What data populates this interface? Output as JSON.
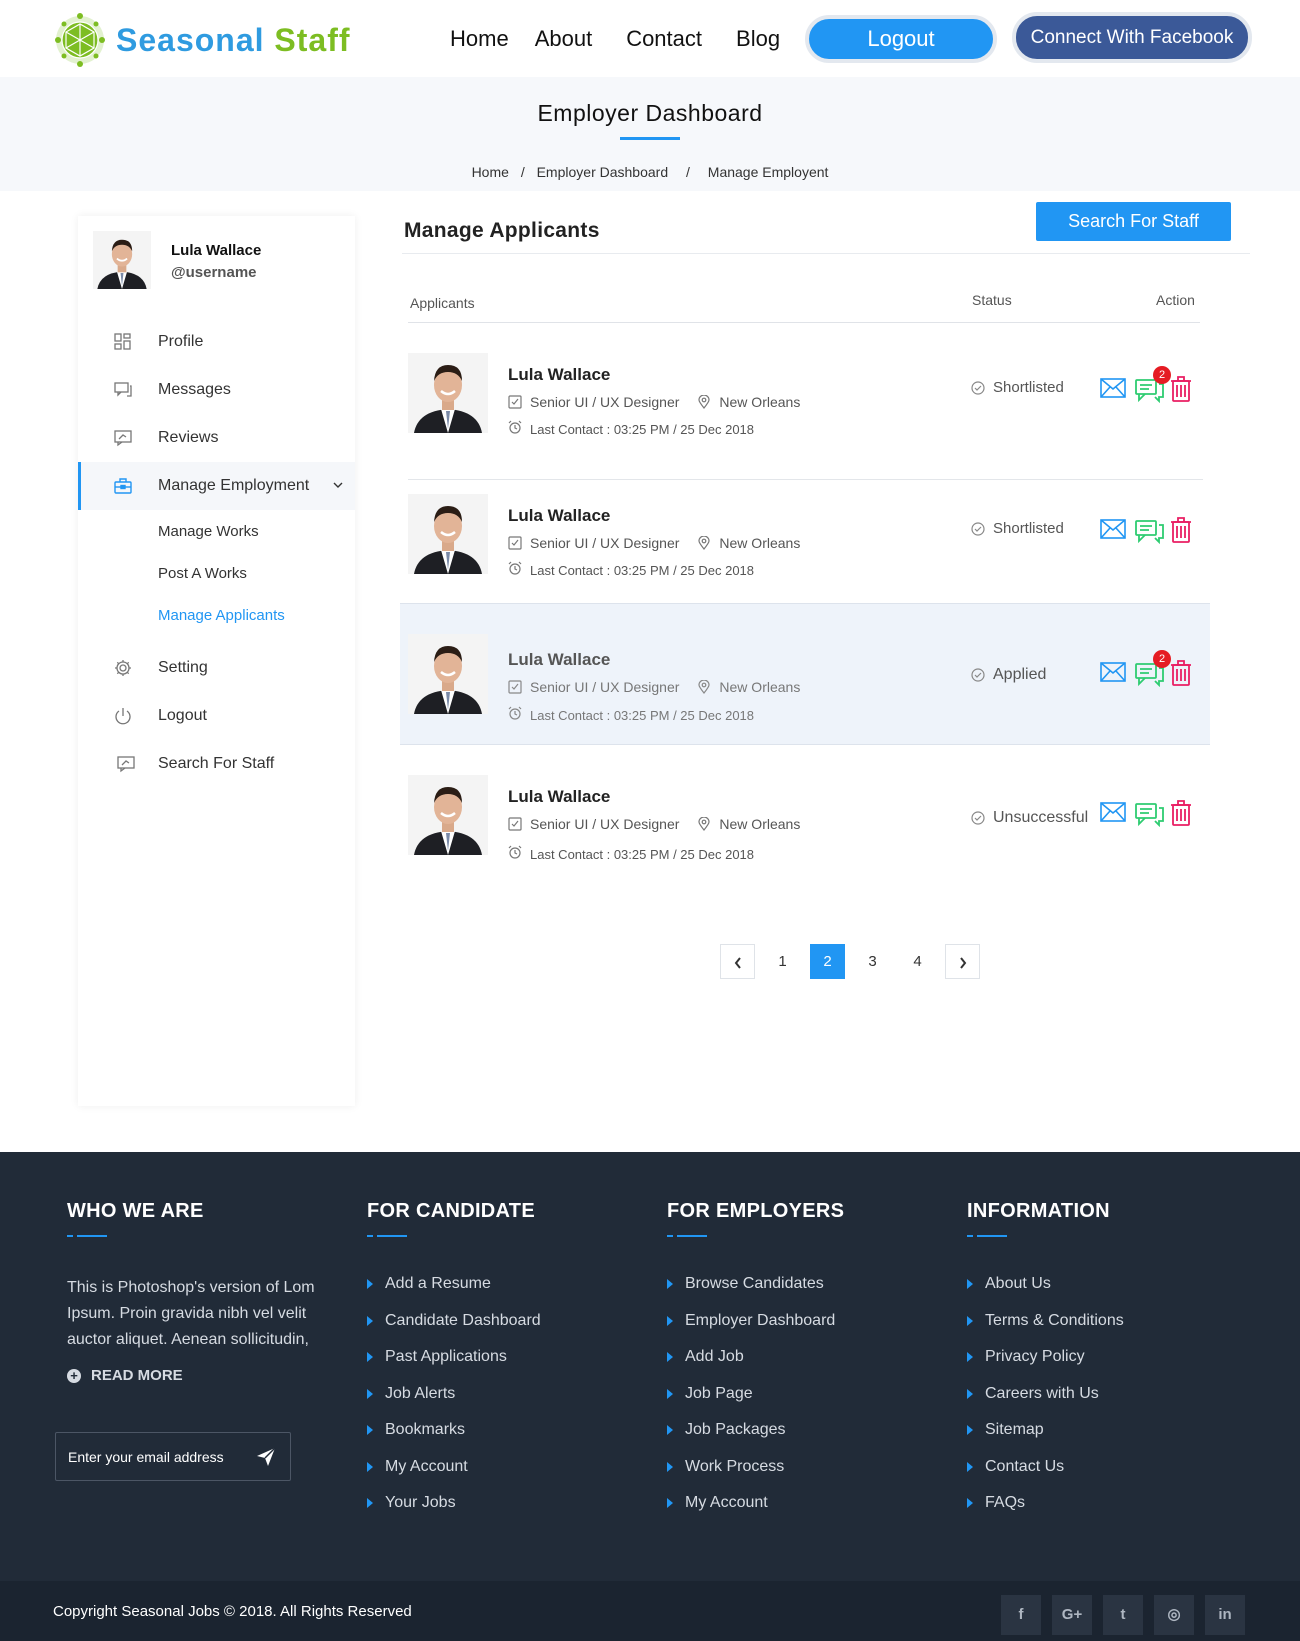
{
  "brand": {
    "part1": "Seasonal",
    "part2": "Staff"
  },
  "nav": {
    "home": "Home",
    "about": "About",
    "contact": "Contact",
    "blog": "Blog",
    "logout": "Logout",
    "facebook": "Connect With Facebook"
  },
  "hero": {
    "title": "Employer Dashboard",
    "crumbs": [
      "Home",
      "/",
      "Employer Dashboard",
      "/",
      "Manage Employent"
    ]
  },
  "sidebar": {
    "name": "Lula Wallace",
    "username": "@username",
    "items": [
      "Profile",
      "Messages",
      "Reviews",
      "Manage Employment",
      "Setting",
      "Logout",
      "Search For Staff"
    ],
    "sub": [
      "Manage Works",
      "Post A Works",
      "Manage Applicants"
    ]
  },
  "main": {
    "title": "Manage Applicants",
    "search_button": "Search For Staff",
    "col_applicants": "Applicants",
    "col_status": "Status",
    "col_action": "Action"
  },
  "applicants": [
    {
      "name": "Lula Wallace",
      "role": "Senior UI / UX Designer",
      "location": "New Orleans",
      "last_contact": "Last Contact : 03:25 PM / 25 Dec 2018",
      "status": "Shortlisted",
      "badge": "2"
    },
    {
      "name": "Lula Wallace",
      "role": "Senior UI / UX Designer",
      "location": "New Orleans",
      "last_contact": "Last Contact : 03:25 PM / 25 Dec 2018",
      "status": "Shortlisted",
      "badge": ""
    },
    {
      "name": "Lula Wallace",
      "role": "Senior UI / UX Designer",
      "location": "New Orleans",
      "last_contact": "Last Contact : 03:25 PM / 25 Dec 2018",
      "status": "Applied",
      "badge": "2"
    },
    {
      "name": "Lula Wallace",
      "role": "Senior UI / UX Designer",
      "location": "New Orleans",
      "last_contact": "Last Contact : 03:25 PM / 25 Dec 2018",
      "status": "Unsuccessful",
      "badge": ""
    }
  ],
  "pagination": {
    "pages": [
      "1",
      "2",
      "3",
      "4"
    ],
    "current": "2"
  },
  "footer": {
    "who": {
      "title": "WHO WE ARE",
      "text": "This is Photoshop's version of Lom Ipsum. Proin gravida nibh vel velit auctor aliquet. Aenean sollicitudin,",
      "read_more": "READ MORE",
      "email_placeholder": "Enter your email address"
    },
    "candidate": {
      "title": "FOR CANDIDATE",
      "links": [
        "Add a Resume",
        "Candidate Dashboard",
        "Past Applications",
        "Job Alerts",
        "Bookmarks",
        "My Account",
        "Your Jobs"
      ]
    },
    "employers": {
      "title": "FOR EMPLOYERS",
      "links": [
        "Browse Candidates",
        "Employer Dashboard",
        "Add Job",
        "Job Page",
        "Job Packages",
        "Work Process",
        "My Account"
      ]
    },
    "info": {
      "title": "INFORMATION",
      "links": [
        "About Us",
        "Terms & Conditions",
        "Privacy Policy",
        "Careers with Us",
        "Sitemap",
        "Contact Us",
        "FAQs"
      ]
    },
    "copyright": "Copyright Seasonal Jobs © 2018. All Rights Reserved",
    "social": [
      "f",
      "G+",
      "t",
      "◎",
      "in"
    ]
  },
  "colors": {
    "accent": "#2196f3",
    "brand_green": "#7dbd22",
    "footer_bg": "#212b38",
    "chat_green": "#2ecc71",
    "delete_red": "#e91e63"
  }
}
